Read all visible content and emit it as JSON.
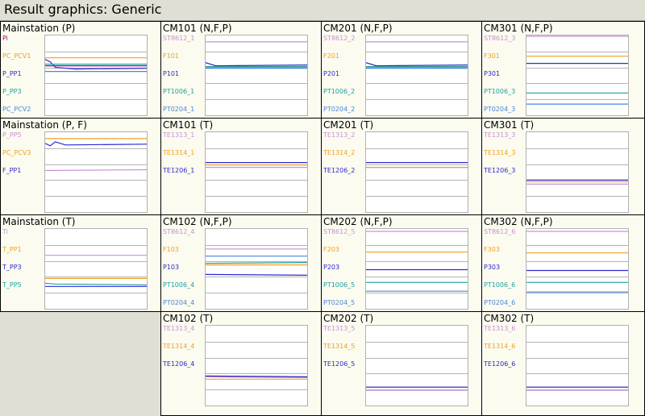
{
  "window_title": "Result graphics: Generic",
  "panels": [
    {
      "title": "Mainstation (P)",
      "signals": [
        {
          "label": "Pi",
          "color": "#b0007a",
          "trace": [
            [
              0,
              0.38
            ],
            [
              1,
              0.38
            ]
          ]
        },
        {
          "label": "PC_PCV1",
          "color": "#f0a020",
          "trace": [
            [
              0,
              0.28
            ],
            [
              1,
              0.28
            ]
          ]
        },
        {
          "label": "P_PP1",
          "color": "#2a2ad0",
          "trace": [
            [
              0,
              0.3
            ],
            [
              0.05,
              0.33
            ],
            [
              0.1,
              0.4
            ],
            [
              0.3,
              0.42
            ],
            [
              1,
              0.41
            ]
          ]
        },
        {
          "label": "P_PP3",
          "color": "#20a0a0",
          "trace": [
            [
              0,
              0.36
            ],
            [
              1,
              0.36
            ]
          ]
        },
        {
          "label": "PC_PCV2",
          "color": "#4a86d8",
          "trace": [
            [
              0,
              0.45
            ],
            [
              1,
              0.45
            ]
          ]
        }
      ]
    },
    {
      "title": "CM101 (N,F,P)",
      "signals": [
        {
          "label": "ST8612_1",
          "color": "#c890d8",
          "trace": [
            [
              0,
              0.08
            ],
            [
              1,
              0.08
            ]
          ]
        },
        {
          "label": "F101",
          "color": "#f0a020",
          "trace": [
            [
              0,
              0.4
            ],
            [
              1,
              0.4
            ]
          ]
        },
        {
          "label": "P101",
          "color": "#2a2ad0",
          "trace": [
            [
              0,
              0.34
            ],
            [
              0.1,
              0.38
            ],
            [
              1,
              0.37
            ]
          ]
        },
        {
          "label": "PT1006_1",
          "color": "#20a0a0",
          "trace": [
            [
              0,
              0.39
            ],
            [
              1,
              0.39
            ]
          ]
        },
        {
          "label": "PT0204_1",
          "color": "#4a86d8",
          "trace": [
            [
              0,
              0.41
            ],
            [
              1,
              0.41
            ]
          ]
        }
      ]
    },
    {
      "title": "CM201 (N,F,P)",
      "signals": [
        {
          "label": "ST8612_2",
          "color": "#c890d8",
          "trace": [
            [
              0,
              0.08
            ],
            [
              1,
              0.08
            ]
          ]
        },
        {
          "label": "F201",
          "color": "#f0a020",
          "trace": [
            [
              0,
              0.4
            ],
            [
              1,
              0.4
            ]
          ]
        },
        {
          "label": "P201",
          "color": "#2a2ad0",
          "trace": [
            [
              0,
              0.34
            ],
            [
              0.1,
              0.38
            ],
            [
              1,
              0.37
            ]
          ]
        },
        {
          "label": "PT1006_2",
          "color": "#20a0a0",
          "trace": [
            [
              0,
              0.39
            ],
            [
              1,
              0.39
            ]
          ]
        },
        {
          "label": "PT0204_2",
          "color": "#4a86d8",
          "trace": [
            [
              0,
              0.41
            ],
            [
              1,
              0.41
            ]
          ]
        }
      ]
    },
    {
      "title": "CM301 (N,F,P)",
      "signals": [
        {
          "label": "ST8612_3",
          "color": "#c890d8",
          "trace": [
            [
              0,
              0.01
            ],
            [
              1,
              0.01
            ]
          ]
        },
        {
          "label": "F301",
          "color": "#f0a020",
          "trace": [
            [
              0,
              0.26
            ],
            [
              1,
              0.26
            ]
          ]
        },
        {
          "label": "P301",
          "color": "#2a2ad0",
          "trace": [
            [
              0,
              0.35
            ],
            [
              1,
              0.35
            ]
          ]
        },
        {
          "label": "PT1006_3",
          "color": "#20a0a0",
          "trace": [
            [
              0,
              0.72
            ],
            [
              1,
              0.72
            ]
          ]
        },
        {
          "label": "PT0204_3",
          "color": "#4a86d8",
          "trace": [
            [
              0,
              0.86
            ],
            [
              1,
              0.86
            ]
          ]
        }
      ]
    },
    {
      "title": "Mainstation (P, F)",
      "signals": [
        {
          "label": "P_PP5",
          "color": "#c890d8",
          "trace": [
            [
              0,
              0.48
            ],
            [
              1,
              0.47
            ]
          ]
        },
        {
          "label": "PC_PCV3",
          "color": "#f0a020",
          "trace": [
            [
              0,
              0.08
            ],
            [
              1,
              0.08
            ]
          ]
        },
        {
          "label": "F_PP1",
          "color": "#2a2ad0",
          "trace": [
            [
              0,
              0.14
            ],
            [
              0.05,
              0.17
            ],
            [
              0.1,
              0.12
            ],
            [
              0.2,
              0.16
            ],
            [
              1,
              0.15
            ]
          ]
        }
      ]
    },
    {
      "title": "CM101 (T)",
      "signals": [
        {
          "label": "TE1313_1",
          "color": "#c890d8",
          "trace": [
            [
              0,
              0.44
            ],
            [
              1,
              0.44
            ]
          ]
        },
        {
          "label": "TE1314_1",
          "color": "#f0a020",
          "trace": [
            [
              0,
              0.41
            ],
            [
              1,
              0.41
            ]
          ]
        },
        {
          "label": "TE1206_1",
          "color": "#2a2ad0",
          "trace": [
            [
              0,
              0.38
            ],
            [
              1,
              0.38
            ]
          ]
        }
      ]
    },
    {
      "title": "CM201 (T)",
      "signals": [
        {
          "label": "TE1313_2",
          "color": "#c890d8",
          "trace": [
            [
              0,
              0.44
            ],
            [
              1,
              0.44
            ]
          ]
        },
        {
          "label": "TE1314_2",
          "color": "#f0a020",
          "trace": [
            [
              0,
              0.44
            ],
            [
              1,
              0.44
            ]
          ]
        },
        {
          "label": "TE1206_2",
          "color": "#2a2ad0",
          "trace": [
            [
              0,
              0.38
            ],
            [
              1,
              0.38
            ]
          ]
        }
      ]
    },
    {
      "title": "CM301 (T)",
      "signals": [
        {
          "label": "TE1313_3",
          "color": "#c890d8",
          "trace": [
            [
              0,
              0.65
            ],
            [
              1,
              0.65
            ]
          ]
        },
        {
          "label": "TE1314_3",
          "color": "#f0a020",
          "trace": [
            [
              0,
              0.62
            ],
            [
              1,
              0.62
            ]
          ]
        },
        {
          "label": "TE1206_3",
          "color": "#2a2ad0",
          "trace": [
            [
              0,
              0.6
            ],
            [
              1,
              0.6
            ]
          ]
        }
      ]
    },
    {
      "title": "Mainstation (T)",
      "signals": [
        {
          "label": "Ti",
          "color": "#c890d8",
          "trace": [
            [
              0,
              0.33
            ],
            [
              1,
              0.33
            ]
          ]
        },
        {
          "label": "T_PP1",
          "color": "#f0a020",
          "trace": [
            [
              0,
              0.62
            ],
            [
              1,
              0.62
            ]
          ]
        },
        {
          "label": "T_PP3",
          "color": "#2a2ad0",
          "trace": [
            [
              0,
              0.72
            ],
            [
              1,
              0.72
            ]
          ]
        },
        {
          "label": "T_PP5",
          "color": "#20a0a0",
          "trace": [
            [
              0,
              0.68
            ],
            [
              0.1,
              0.69
            ],
            [
              1,
              0.7
            ]
          ]
        }
      ]
    },
    {
      "title": "CM102 (N,F,P)",
      "signals": [
        {
          "label": "ST8612_4",
          "color": "#c890d8",
          "trace": [
            [
              0,
              0.25
            ],
            [
              1,
              0.25
            ]
          ]
        },
        {
          "label": "F103",
          "color": "#f0a020",
          "trace": [
            [
              0,
              0.45
            ],
            [
              1,
              0.45
            ]
          ]
        },
        {
          "label": "P103",
          "color": "#2a2ad0",
          "trace": [
            [
              0,
              0.57
            ],
            [
              1,
              0.58
            ]
          ]
        },
        {
          "label": "PT1006_4",
          "color": "#20a0a0",
          "trace": [
            [
              0,
              0.43
            ],
            [
              1,
              0.42
            ]
          ]
        },
        {
          "label": "PT0204_4",
          "color": "#4a86d8",
          "trace": [
            [
              0,
              0.34
            ],
            [
              1,
              0.34
            ]
          ]
        }
      ]
    },
    {
      "title": "CM202 (N,F,P)",
      "signals": [
        {
          "label": "ST8612_5",
          "color": "#c890d8",
          "trace": [
            [
              0,
              0.03
            ],
            [
              1,
              0.03
            ]
          ]
        },
        {
          "label": "F203",
          "color": "#f0a020",
          "trace": [
            [
              0,
              0.29
            ],
            [
              1,
              0.29
            ]
          ]
        },
        {
          "label": "P203",
          "color": "#2a2ad0",
          "trace": [
            [
              0,
              0.51
            ],
            [
              1,
              0.51
            ]
          ]
        },
        {
          "label": "PT1006_5",
          "color": "#20a0a0",
          "trace": [
            [
              0,
              0.67
            ],
            [
              1,
              0.67
            ]
          ]
        },
        {
          "label": "PT0204_5",
          "color": "#4a86d8",
          "trace": [
            [
              0,
              0.78
            ],
            [
              1,
              0.78
            ]
          ]
        }
      ]
    },
    {
      "title": "CM302 (N,F,P)",
      "signals": [
        {
          "label": "ST8612_6",
          "color": "#c890d8",
          "trace": [
            [
              0,
              0.03
            ],
            [
              1,
              0.03
            ]
          ]
        },
        {
          "label": "F303",
          "color": "#f0a020",
          "trace": [
            [
              0,
              0.3
            ],
            [
              1,
              0.3
            ]
          ]
        },
        {
          "label": "P303",
          "color": "#2a2ad0",
          "trace": [
            [
              0,
              0.52
            ],
            [
              1,
              0.52
            ]
          ]
        },
        {
          "label": "PT1006_6",
          "color": "#20a0a0",
          "trace": [
            [
              0,
              0.67
            ],
            [
              1,
              0.67
            ]
          ]
        },
        {
          "label": "PT0204_6",
          "color": "#4a86d8",
          "trace": [
            [
              0,
              0.79
            ],
            [
              1,
              0.79
            ]
          ]
        }
      ]
    },
    {
      "title": "CM102 (T)",
      "signals": [
        {
          "label": "TE1313_4",
          "color": "#c890d8",
          "trace": [
            [
              0,
              0.64
            ],
            [
              1,
              0.65
            ]
          ]
        },
        {
          "label": "TE1314_4",
          "color": "#f0a020",
          "trace": [
            [
              0,
              0.67
            ],
            [
              1,
              0.67
            ]
          ]
        },
        {
          "label": "TE1206_4",
          "color": "#2a2ad0",
          "trace": [
            [
              0,
              0.63
            ],
            [
              1,
              0.64
            ]
          ]
        }
      ]
    },
    {
      "title": "CM202 (T)",
      "signals": [
        {
          "label": "TE1313_5",
          "color": "#c890d8",
          "trace": [
            [
              0,
              0.81
            ],
            [
              1,
              0.81
            ]
          ]
        },
        {
          "label": "TE1314_5",
          "color": "#f0a020",
          "trace": [
            [
              0,
              0.77
            ],
            [
              1,
              0.77
            ]
          ]
        },
        {
          "label": "TE1206_5",
          "color": "#2a2ad0",
          "trace": [
            [
              0,
              0.77
            ],
            [
              1,
              0.77
            ]
          ]
        }
      ]
    },
    {
      "title": "CM302 (T)",
      "signals": [
        {
          "label": "TE1313_6",
          "color": "#c890d8",
          "trace": [
            [
              0,
              0.81
            ],
            [
              1,
              0.81
            ]
          ]
        },
        {
          "label": "TE1314_6",
          "color": "#f0a020",
          "trace": [
            [
              0,
              0.77
            ],
            [
              1,
              0.77
            ]
          ]
        },
        {
          "label": "TE1206_6",
          "color": "#2a2ad0",
          "trace": [
            [
              0,
              0.77
            ],
            [
              1,
              0.77
            ]
          ]
        }
      ]
    }
  ]
}
